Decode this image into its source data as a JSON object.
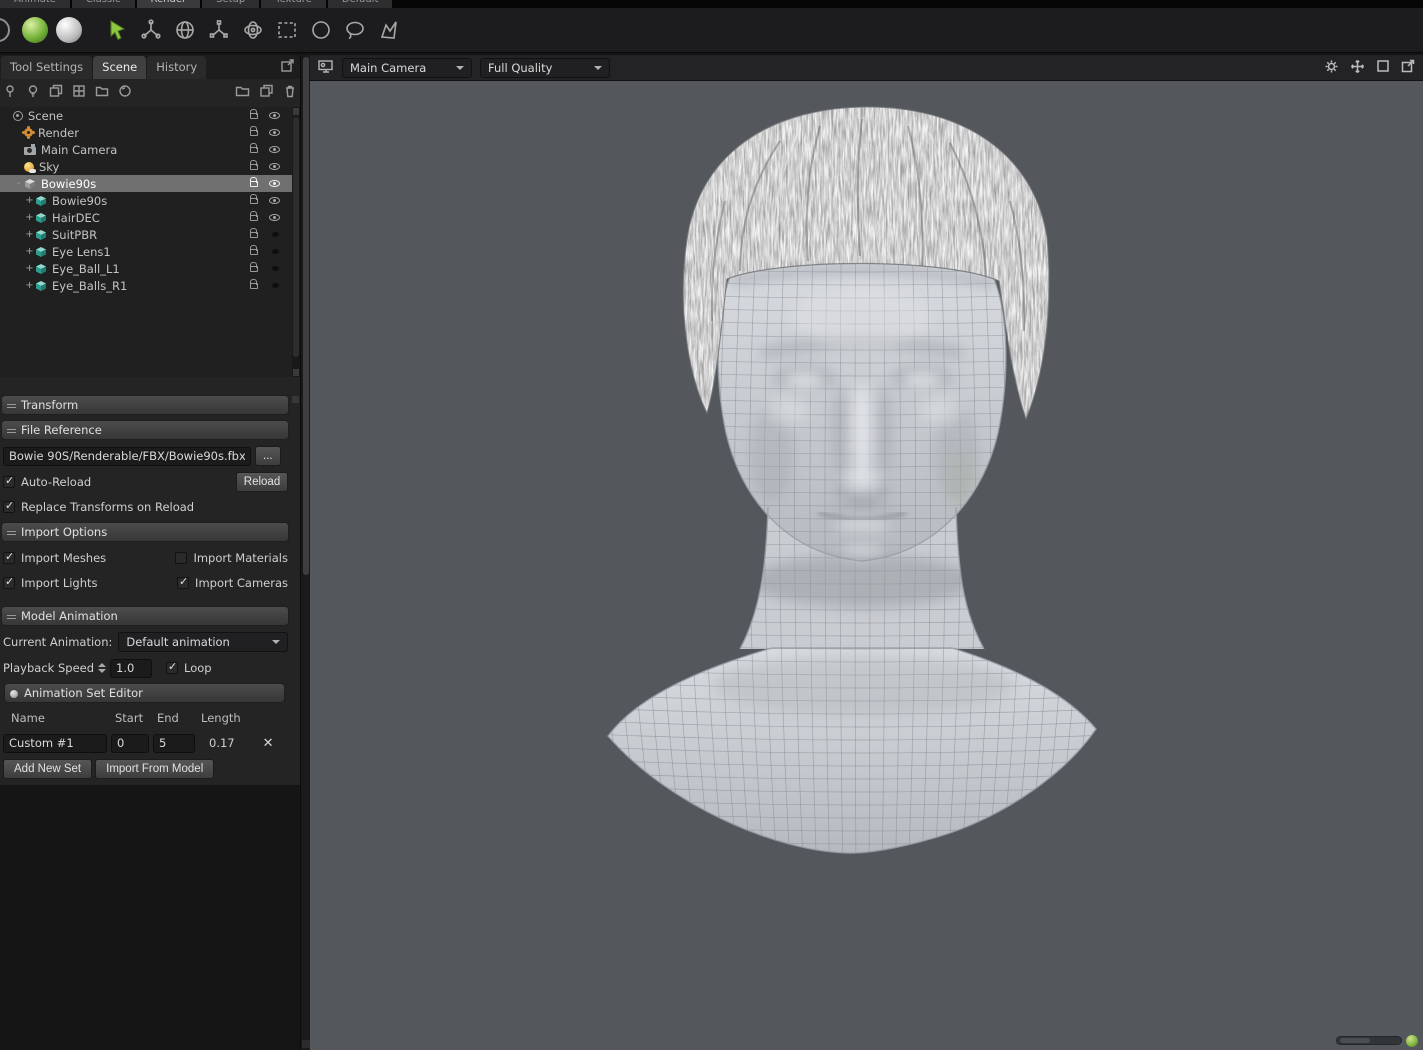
{
  "colors": {
    "accent_green": "#7cb342",
    "viewport_bg": "#54575c",
    "selection_gray": "#707070"
  },
  "top_tabs": {
    "items": [
      "Animate",
      "Classic",
      "Render",
      "Setup",
      "Texture",
      "Default"
    ]
  },
  "toolbar": {
    "icons": [
      "ring-sphere",
      "green-sphere",
      "light-sphere",
      "select-cursor",
      "move-tool",
      "rotate-tool",
      "scale-tool",
      "gyro-tool",
      "rect-select",
      "ellipse-select",
      "lasso-select",
      "polyline-select"
    ]
  },
  "left_panel": {
    "tabs": [
      {
        "label": "Tool Settings",
        "active": false
      },
      {
        "label": "Scene",
        "active": true
      },
      {
        "label": "History",
        "active": false
      }
    ],
    "item_toolbar_icons": [
      "pin",
      "bulb",
      "layers",
      "cloth",
      "folder",
      "shader-ball",
      "new-folder",
      "duplicate",
      "trash"
    ],
    "tree": {
      "rows": [
        {
          "label": "Scene",
          "depth": 0,
          "expander": "",
          "icon": "scene",
          "selected": false,
          "visibility": "visible"
        },
        {
          "label": "Render",
          "depth": 1,
          "expander": "",
          "icon": "render",
          "selected": false,
          "visibility": "visible"
        },
        {
          "label": "Main Camera",
          "depth": 1,
          "expander": "",
          "icon": "camera",
          "selected": false,
          "visibility": "visible"
        },
        {
          "label": "Sky",
          "depth": 1,
          "expander": "",
          "icon": "sky",
          "selected": false,
          "visibility": "visible"
        },
        {
          "label": "Bowie90s",
          "depth": 1,
          "expander": "-",
          "icon": "model",
          "selected": true,
          "visibility": "visible"
        },
        {
          "label": "Bowie90s",
          "depth": 2,
          "expander": "+",
          "icon": "mesh",
          "selected": false,
          "visibility": "visible"
        },
        {
          "label": "HairDEC",
          "depth": 2,
          "expander": "+",
          "icon": "mesh",
          "selected": false,
          "visibility": "visible"
        },
        {
          "label": "SuitPBR",
          "depth": 2,
          "expander": "+",
          "icon": "mesh",
          "selected": false,
          "visibility": "hidden"
        },
        {
          "label": "Eye Lens1",
          "depth": 2,
          "expander": "+",
          "icon": "mesh",
          "selected": false,
          "visibility": "hidden"
        },
        {
          "label": "Eye_Ball_L1",
          "depth": 2,
          "expander": "+",
          "icon": "mesh",
          "selected": false,
          "visibility": "hidden"
        },
        {
          "label": "Eye_Balls_R1",
          "depth": 2,
          "expander": "+",
          "icon": "mesh",
          "selected": false,
          "visibility": "hidden"
        }
      ]
    },
    "transform": {
      "title": "Transform"
    },
    "file_reference": {
      "title": "File Reference",
      "path": "Bowie 90S/Renderable/FBX/Bowie90s.fbx",
      "browse_label": "...",
      "auto_reload_label": "Auto-Reload",
      "auto_reload_checked": true,
      "reload_button": "Reload",
      "replace_label": "Replace Transforms on Reload",
      "replace_checked": true
    },
    "import_options": {
      "title": "Import Options",
      "options": [
        {
          "label": "Import Meshes",
          "checked": true
        },
        {
          "label": "Import Materials",
          "checked": false
        },
        {
          "label": "Import Lights",
          "checked": true
        },
        {
          "label": "Import Cameras",
          "checked": true
        }
      ]
    },
    "model_animation": {
      "title": "Model Animation",
      "current_animation_label": "Current Animation:",
      "current_animation_value": "Default animation",
      "playback_speed_label": "Playback Speed",
      "playback_speed_value": "1.0",
      "loop_label": "Loop",
      "loop_checked": true
    },
    "animation_sets": {
      "title": "Animation Set Editor",
      "columns": [
        "Name",
        "Start",
        "End",
        "Length"
      ],
      "rows": [
        {
          "name": "Custom #1",
          "start": "0",
          "end": "5",
          "length": "0.17",
          "delete_label": "✕"
        }
      ],
      "add_button": "Add New Set",
      "import_button": "Import From Model"
    }
  },
  "viewport": {
    "camera": "Main Camera",
    "quality": "Full Quality",
    "header_icons": [
      "viewport-type",
      "gear",
      "pan",
      "maximize",
      "popout"
    ],
    "model": "wireframe head bust"
  }
}
